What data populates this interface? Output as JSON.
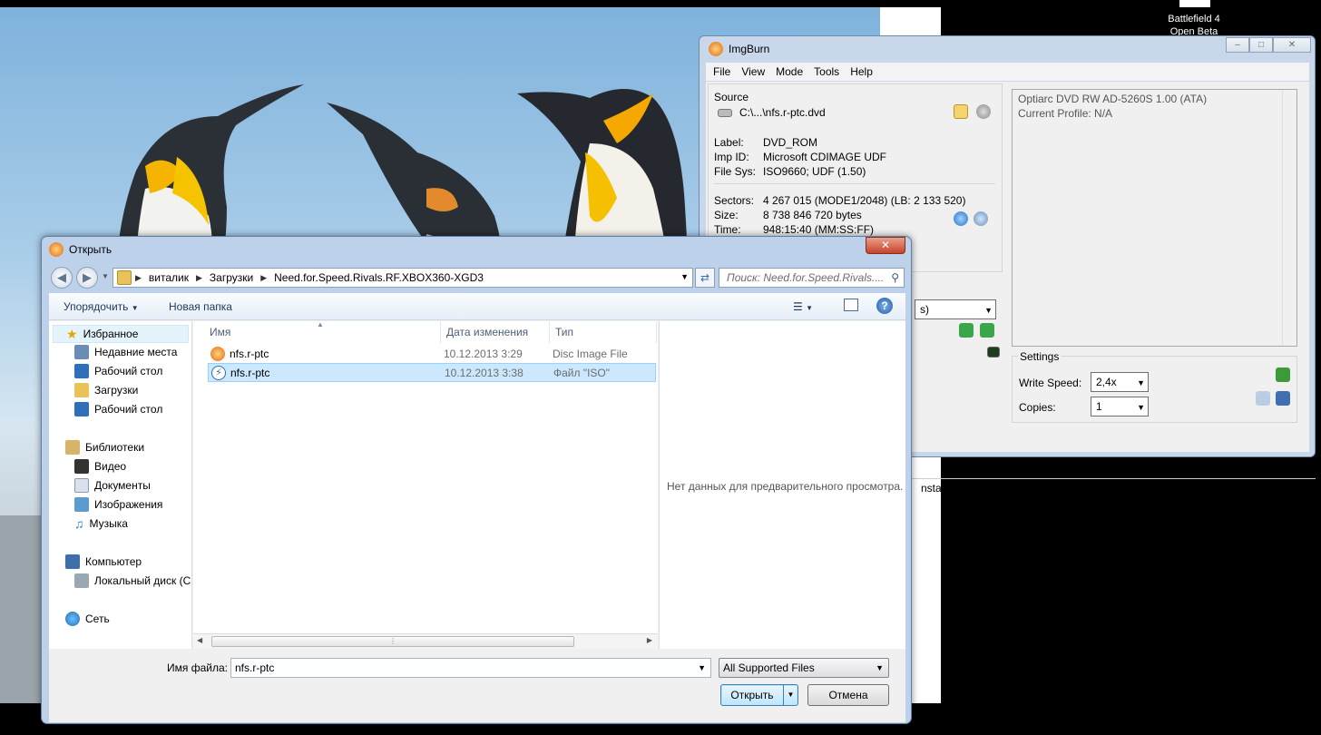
{
  "desktop": {
    "icon_label": "Battlefield 4\nOpen Beta"
  },
  "imgburn": {
    "title": "ImgBurn",
    "menu": [
      "File",
      "View",
      "Mode",
      "Tools",
      "Help"
    ],
    "source_label": "Source",
    "source_path": "C:\\...\\nfs.r-ptc.dvd",
    "label_key": "Label:",
    "label_val": "DVD_ROM",
    "impid_key": "Imp ID:",
    "impid_val": "Microsoft CDIMAGE UDF",
    "filesys_key": "File Sys:",
    "filesys_val": "ISO9660; UDF (1.50)",
    "sectors_key": "Sectors:",
    "sectors_val": "4 267 015 (MODE1/2048) (LB: 2 133 520)",
    "size_key": "Size:",
    "size_val": "8 738 846 720 bytes",
    "time_key": "Time:",
    "time_val": "948:15:40 (MM:SS:FF)",
    "drive_combo_fragment": "s)",
    "info_line1": "Optiarc DVD RW AD-5260S 1.00 (ATA)",
    "info_line2": "Current Profile: N/A",
    "settings_label": "Settings",
    "write_speed_label": "Write Speed:",
    "write_speed_value": "2,4x",
    "copies_label": "Copies:",
    "copies_value": "1",
    "status_fragment": "nstalled)"
  },
  "dialog": {
    "title": "Открыть",
    "breadcrumb": [
      "виталик",
      "Загрузки",
      "Need.for.Speed.Rivals.RF.XBOX360-XGD3"
    ],
    "search_placeholder": "Поиск: Need.for.Speed.Rivals....",
    "toolbar": {
      "organize": "Упорядочить",
      "new_folder": "Новая папка"
    },
    "nav": {
      "favorites": "Избранное",
      "recent": "Недавние места",
      "desktop1": "Рабочий стол",
      "downloads": "Загрузки",
      "desktop2": "Рабочий стол",
      "libraries": "Библиотеки",
      "video": "Видео",
      "documents": "Документы",
      "images": "Изображения",
      "music": "Музыка",
      "computer": "Компьютер",
      "localdisk": "Локальный диск (С",
      "network": "Сеть"
    },
    "columns": {
      "name": "Имя",
      "date": "Дата изменения",
      "type": "Тип"
    },
    "files": [
      {
        "name": "nfs.r-ptc",
        "date": "10.12.2013 3:29",
        "type": "Disc Image File"
      },
      {
        "name": "nfs.r-ptc",
        "date": "10.12.2013 3:38",
        "type": "Файл \"ISO\""
      }
    ],
    "preview_text": "Нет данных для предварительного просмотра.",
    "filename_label": "Имя файла:",
    "filename_value": "nfs.r-ptc",
    "filetype_value": "All Supported Files",
    "open_button": "Открыть",
    "cancel_button": "Отмена"
  }
}
